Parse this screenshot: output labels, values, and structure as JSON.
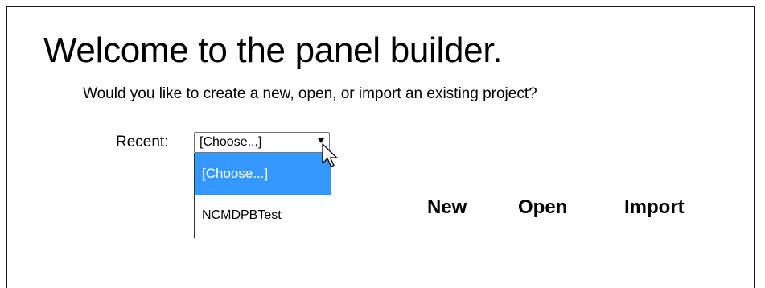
{
  "welcome": {
    "title": "Welcome to the panel builder.",
    "subtitle": "Would you like to create a new, open, or import an existing project?"
  },
  "recent": {
    "label": "Recent:",
    "selected_value": "[Choose...]",
    "options": [
      {
        "label": "[Choose...]",
        "highlighted": true
      },
      {
        "label": "NCMDPBTest",
        "highlighted": false
      }
    ]
  },
  "actions": {
    "new_label": "New",
    "open_label": "Open",
    "import_label": "Import"
  },
  "colors": {
    "highlight": "#3399ff",
    "highlight_text": "#ffffff",
    "text": "#000000",
    "background": "#ffffff"
  },
  "icons": {
    "cursor": "mouse-pointer-icon",
    "dropdown_arrow": "chevron-down-icon"
  }
}
